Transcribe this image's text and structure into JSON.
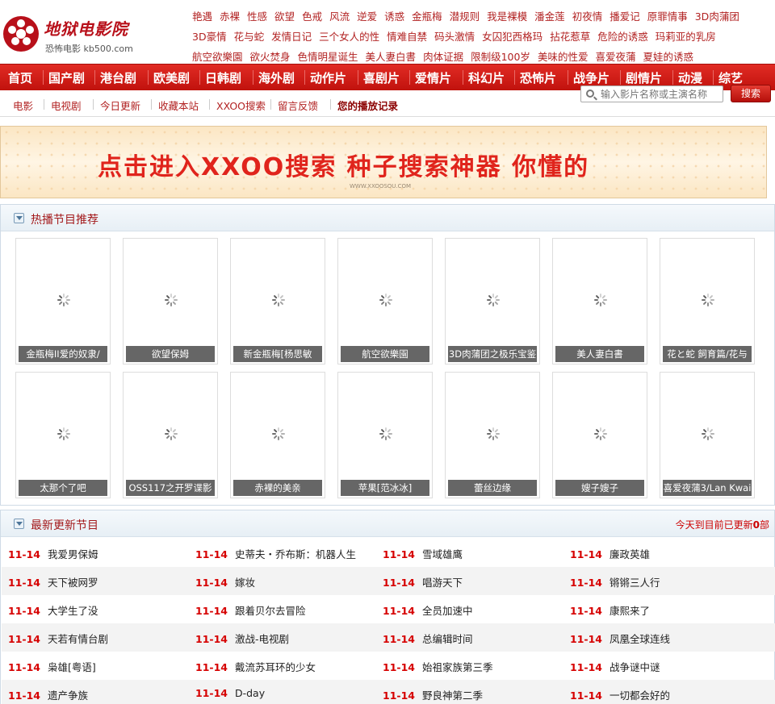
{
  "site": {
    "logo_text": "地狱电影院",
    "logo_sub": "恐怖电影 kb500.com"
  },
  "hot_tags": [
    "艳遇",
    "赤裸",
    "性感",
    "欲望",
    "色戒",
    "风流",
    "逆爱",
    "诱惑",
    "金瓶梅",
    "潜规则",
    "我是裸模",
    "潘金莲",
    "初夜情",
    "播爱记",
    "原罪情事",
    "3D肉蒲团",
    "3D豪情",
    "花与蛇",
    "发情日记",
    "三个女人的性",
    "情难自禁",
    "码头激情",
    "女囚犯西格玛",
    "拈花惹草",
    "危险的诱惑",
    "玛莉亚的乳房",
    "航空欲樂園",
    "欲火焚身",
    "色情明星诞生",
    "美人妻白書",
    "肉体证据",
    "限制级100岁",
    "美味的性爱",
    "喜爱夜蒲",
    "夏娃的诱惑"
  ],
  "nav": [
    "首页",
    "国产剧",
    "港台剧",
    "欧美剧",
    "日韩剧",
    "海外剧",
    "动作片",
    "喜剧片",
    "爱情片",
    "科幻片",
    "恐怖片",
    "战争片",
    "剧情片",
    "动漫",
    "综艺"
  ],
  "subnav": [
    "电影",
    "电视剧",
    "今日更新",
    "收藏本站",
    "XXOO搜索",
    "留言反馈",
    "您的播放记录"
  ],
  "search": {
    "placeholder": "输入影片名称或主演名称",
    "button": "搜索"
  },
  "banner": {
    "text": "点击进入XXOO搜索 种子搜索神器 你懂的",
    "url": "WWW.XXOOSOU.COM"
  },
  "hot_section": {
    "title": "热播节目推荐",
    "items": [
      "金瓶梅II爱的奴隶/",
      "欲望保姆",
      "新金瓶梅[杨思敏",
      "航空欲樂園",
      "3D肉蒲团之极乐宝鉴",
      "美人妻白書",
      "花と蛇 飼育篇/花与",
      "太那个了吧",
      "OSS117之开罗谍影",
      "赤裸的美亲",
      "苹果[范冰冰]",
      "蕾丝边缘",
      "嫂子嫂子",
      "喜爱夜蒲3/Lan Kwai"
    ]
  },
  "update_section": {
    "title": "最新更新节目",
    "stat_prefix": "今天到目前已更新",
    "stat_count": "0",
    "stat_suffix": "部",
    "rows": [
      [
        {
          "date": "11-14",
          "name": "我爱男保姆"
        },
        {
          "date": "11-14",
          "name": "史蒂夫・乔布斯：机器人生"
        },
        {
          "date": "11-14",
          "name": "雪域雄鹰"
        },
        {
          "date": "11-14",
          "name": "廉政英雄"
        }
      ],
      [
        {
          "date": "11-14",
          "name": "天下被网罗"
        },
        {
          "date": "11-14",
          "name": "嫁妆"
        },
        {
          "date": "11-14",
          "name": "唱游天下"
        },
        {
          "date": "11-14",
          "name": "锵锵三人行"
        }
      ],
      [
        {
          "date": "11-14",
          "name": "大学生了没"
        },
        {
          "date": "11-14",
          "name": "跟着贝尔去冒险"
        },
        {
          "date": "11-14",
          "name": "全员加速中"
        },
        {
          "date": "11-14",
          "name": "康熙来了"
        }
      ],
      [
        {
          "date": "11-14",
          "name": "天若有情台剧"
        },
        {
          "date": "11-14",
          "name": "激战-电视剧"
        },
        {
          "date": "11-14",
          "name": "总编辑时间"
        },
        {
          "date": "11-14",
          "name": "凤凰全球连线"
        }
      ],
      [
        {
          "date": "11-14",
          "name": "枭雄[粤语]"
        },
        {
          "date": "11-14",
          "name": "戴流苏耳环的少女"
        },
        {
          "date": "11-14",
          "name": "始祖家族第三季"
        },
        {
          "date": "11-14",
          "name": "战争谜中谜"
        }
      ],
      [
        {
          "date": "11-14",
          "name": "遗产争族"
        },
        {
          "date": "11-14",
          "name": "D-day"
        },
        {
          "date": "11-14",
          "name": "野良神第二季"
        },
        {
          "date": "11-14",
          "name": "一切都会好的"
        }
      ]
    ]
  },
  "colors": {
    "brand_red": "#c0120d",
    "date_red": "#d60000",
    "link_red": "#b22222"
  }
}
